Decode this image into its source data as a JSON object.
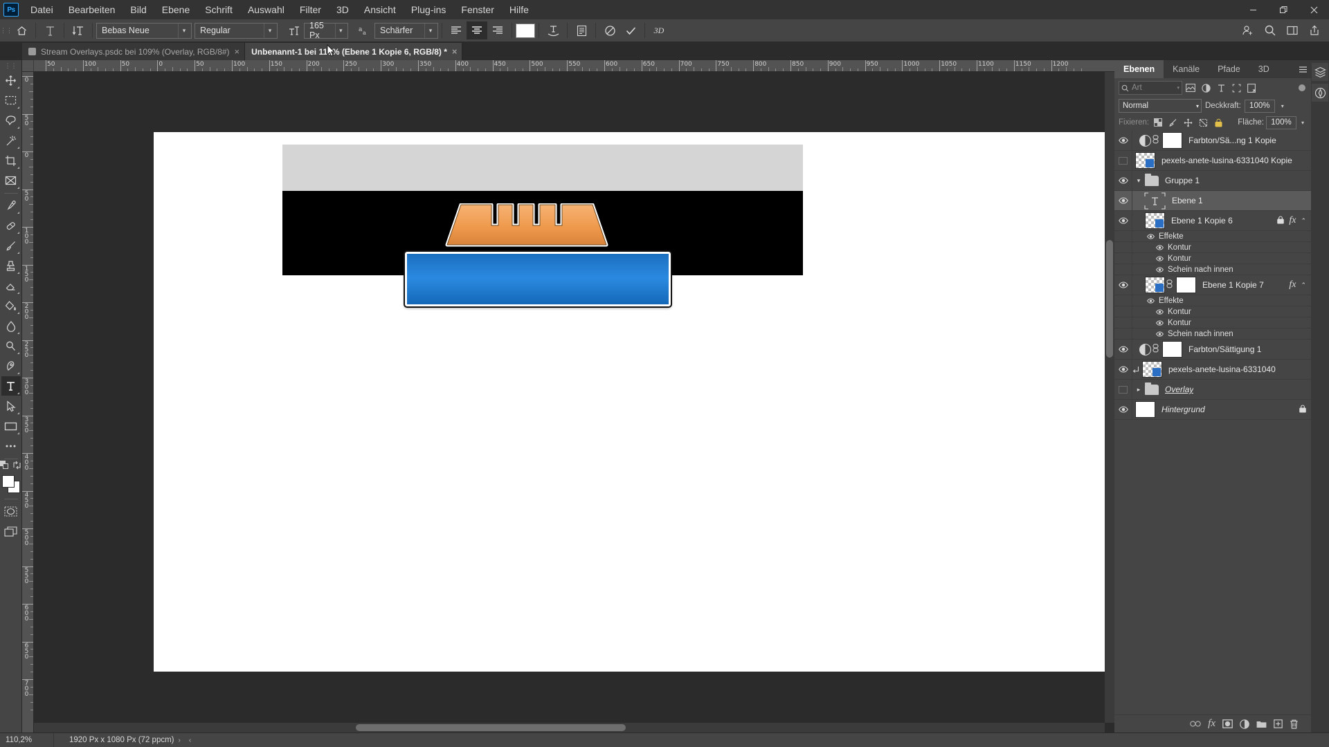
{
  "app": {
    "name": "Ps",
    "logo_label": "Ps"
  },
  "menubar": {
    "items": [
      {
        "label": "Datei"
      },
      {
        "label": "Bearbeiten"
      },
      {
        "label": "Bild"
      },
      {
        "label": "Ebene"
      },
      {
        "label": "Schrift"
      },
      {
        "label": "Auswahl"
      },
      {
        "label": "Filter"
      },
      {
        "label": "3D"
      },
      {
        "label": "Ansicht"
      },
      {
        "label": "Plug-ins"
      },
      {
        "label": "Fenster"
      },
      {
        "label": "Hilfe"
      }
    ],
    "window_controls": [
      {
        "name": "minimize",
        "glyph": "–"
      },
      {
        "name": "restore",
        "glyph": "❐"
      },
      {
        "name": "close",
        "glyph": "✕"
      }
    ]
  },
  "options_bar": {
    "home_icon": "home-icon",
    "tool_preset_icon": "type-tool-icon",
    "orientation_icon": "text-orientation-icon",
    "font_family": "Bebas Neue",
    "font_style": "Regular",
    "font_size": "165 Px",
    "antialias_icon": "anti-alias-icon",
    "antialias_value": "Schärfer",
    "align_left": "align-left-icon",
    "align_center": "align-center-icon",
    "align_right": "align-right-icon",
    "color_swatch": "#ffffff",
    "warp_icon": "warp-text-icon",
    "paragraph_icon": "character-paragraph-panel-icon",
    "cancel_icon": "cancel-icon",
    "commit_icon": "commit-icon",
    "three_d_label": "3D",
    "right_icons": [
      {
        "name": "share-user-icon"
      },
      {
        "name": "search-icon"
      },
      {
        "name": "workspace-icon"
      },
      {
        "name": "share-export-icon"
      }
    ]
  },
  "tabs": [
    {
      "label": "Stream Overlays.psdc bei 109% (Overlay, RGB/8#)",
      "active": false,
      "close": "×",
      "has_cloud_icon": true
    },
    {
      "label": "Unbenannt-1 bei 110% (Ebene 1 Kopie 6, RGB/8) *",
      "active": true,
      "close": "×",
      "has_cloud_icon": false
    }
  ],
  "toolbar": {
    "tools": [
      {
        "name": "move-tool",
        "glyph": "move"
      },
      {
        "name": "rectangular-marquee-tool",
        "glyph": "marquee"
      },
      {
        "name": "lasso-tool",
        "glyph": "lasso"
      },
      {
        "name": "magic-wand-tool",
        "glyph": "wand"
      },
      {
        "name": "crop-tool",
        "glyph": "crop"
      },
      {
        "name": "frame-tool",
        "glyph": "frame"
      },
      {
        "name": "eyedropper-tool",
        "glyph": "eyedropper"
      },
      {
        "name": "spot-healing-brush-tool",
        "glyph": "healing"
      },
      {
        "name": "brush-tool",
        "glyph": "brush"
      },
      {
        "name": "clone-stamp-tool",
        "glyph": "stamp"
      },
      {
        "name": "eraser-tool",
        "glyph": "eraser"
      },
      {
        "name": "gradient-tool",
        "glyph": "bucket"
      },
      {
        "name": "blur-tool",
        "glyph": "blur"
      },
      {
        "name": "dodge-tool",
        "glyph": "dodge"
      },
      {
        "name": "pen-tool",
        "glyph": "pen"
      },
      {
        "name": "horizontal-type-tool",
        "glyph": "type",
        "active": true
      },
      {
        "name": "path-selection-tool",
        "glyph": "arrow"
      },
      {
        "name": "rectangle-tool",
        "glyph": "rect"
      },
      {
        "name": "more-tools",
        "glyph": "ellipsis"
      }
    ],
    "foreground_color": "#ffffff",
    "background_color": "#ffffff",
    "quickmask_name": "quick-mask-icon",
    "screenmode_name": "screen-mode-icon"
  },
  "rulers": {
    "unit": "px",
    "top_labels": [
      "50",
      "100",
      "50",
      "0",
      "50",
      "100",
      "150",
      "200",
      "250",
      "300",
      "350",
      "400",
      "450",
      "500",
      "550",
      "600",
      "650",
      "700",
      "750",
      "800",
      "850",
      "900",
      "950",
      "1000",
      "1050",
      "1100",
      "1150",
      "1200"
    ],
    "left_labels": [
      "0",
      "50",
      "0",
      "50",
      "100",
      "150",
      "200",
      "250",
      "300",
      "350",
      "400",
      "450",
      "500",
      "550",
      "600",
      "650",
      "700"
    ]
  },
  "canvas": {
    "artwork_description": "orange crown-shaped cropped text over blue rounded banner on black bar",
    "gray_band_color": "#d5d5d5",
    "black_band_color": "#000000",
    "orange_color": "#ef9a4d",
    "blue_color": "#2a8ae0",
    "artboard_background": "#ffffff"
  },
  "panel": {
    "tabs": [
      {
        "label": "Ebenen",
        "active": true
      },
      {
        "label": "Kanäle",
        "active": false
      },
      {
        "label": "Pfade",
        "active": false
      },
      {
        "label": "3D",
        "active": false
      }
    ],
    "menu_icon": "panel-menu-icon",
    "filter": {
      "search_placeholder": "Art",
      "search_icon": "search-icon",
      "icons": [
        {
          "name": "filter-pixel-icon"
        },
        {
          "name": "filter-adjustment-icon"
        },
        {
          "name": "filter-type-icon"
        },
        {
          "name": "filter-shape-icon"
        },
        {
          "name": "filter-smartobject-icon"
        }
      ],
      "toggle": "filter-toggle"
    },
    "blend_mode": "Normal",
    "opacity_label": "Deckkraft:",
    "opacity_value": "100%",
    "lock_label": "Fixieren:",
    "fill_label": "Fläche:",
    "fill_value": "100%",
    "lock_icons": [
      {
        "name": "lock-transparent-pixels-icon"
      },
      {
        "name": "lock-image-pixels-icon"
      },
      {
        "name": "lock-position-icon"
      },
      {
        "name": "lock-artboard-nesting-icon"
      },
      {
        "name": "lock-all-icon"
      }
    ],
    "layers": [
      {
        "type": "layer",
        "name": "Farbton/Sä...ng 1 Kopie",
        "visible": true,
        "kind": "adjustment",
        "indent": 0,
        "linked": true,
        "has_mask": true,
        "selected": false
      },
      {
        "type": "layer",
        "name": "pexels-anete-lusina-6331040 Kopie",
        "visible": false,
        "kind": "smart",
        "indent": 0,
        "selected": false
      },
      {
        "type": "group",
        "name": "Gruppe 1",
        "visible": true,
        "expanded": true,
        "indent": 0,
        "selected": false
      },
      {
        "type": "layer",
        "name": "Ebene 1",
        "visible": true,
        "kind": "text",
        "indent": 1,
        "selected": true
      },
      {
        "type": "layer",
        "name": "Ebene 1 Kopie 6",
        "visible": true,
        "kind": "smart",
        "indent": 1,
        "locked": true,
        "fx": true,
        "selected": false,
        "effects": {
          "label": "Effekte",
          "items": [
            "Kontur",
            "Kontur",
            "Schein nach innen"
          ]
        }
      },
      {
        "type": "layer",
        "name": "Ebene 1 Kopie 7",
        "visible": true,
        "kind": "smart",
        "indent": 1,
        "has_mask": true,
        "linked": true,
        "fx": true,
        "selected": false,
        "effects": {
          "label": "Effekte",
          "items": [
            "Kontur",
            "Kontur",
            "Schein nach innen"
          ]
        }
      },
      {
        "type": "layer",
        "name": "Farbton/Sättigung 1",
        "visible": true,
        "kind": "adjustment",
        "indent": 0,
        "linked": true,
        "has_mask": true,
        "selected": false
      },
      {
        "type": "layer",
        "name": "pexels-anete-lusina-6331040",
        "visible": true,
        "kind": "smart",
        "indent": 0,
        "clipped": true,
        "selected": false
      },
      {
        "type": "group",
        "name": "Overlay",
        "visible": false,
        "expanded": false,
        "indent": 0,
        "selected": false,
        "style": "underline"
      },
      {
        "type": "layer",
        "name": "Hintergrund",
        "visible": true,
        "kind": "background",
        "indent": 0,
        "locked": true,
        "selected": false,
        "style": "italic"
      }
    ],
    "footer_icons": [
      {
        "name": "link-layers-icon"
      },
      {
        "name": "layer-style-fx-icon"
      },
      {
        "name": "add-layer-mask-icon"
      },
      {
        "name": "new-adjustment-layer-icon"
      },
      {
        "name": "new-group-icon"
      },
      {
        "name": "new-layer-icon"
      },
      {
        "name": "delete-layer-icon"
      }
    ],
    "rail_icons": [
      {
        "name": "layers-rail-icon"
      },
      {
        "name": "libraries-rail-icon"
      }
    ]
  },
  "statusbar": {
    "zoom": "110,2%",
    "dimensions": "1920 Px x 1080 Px (72 ppcm)",
    "next_arrow": "›",
    "prev_arrow": "‹"
  }
}
